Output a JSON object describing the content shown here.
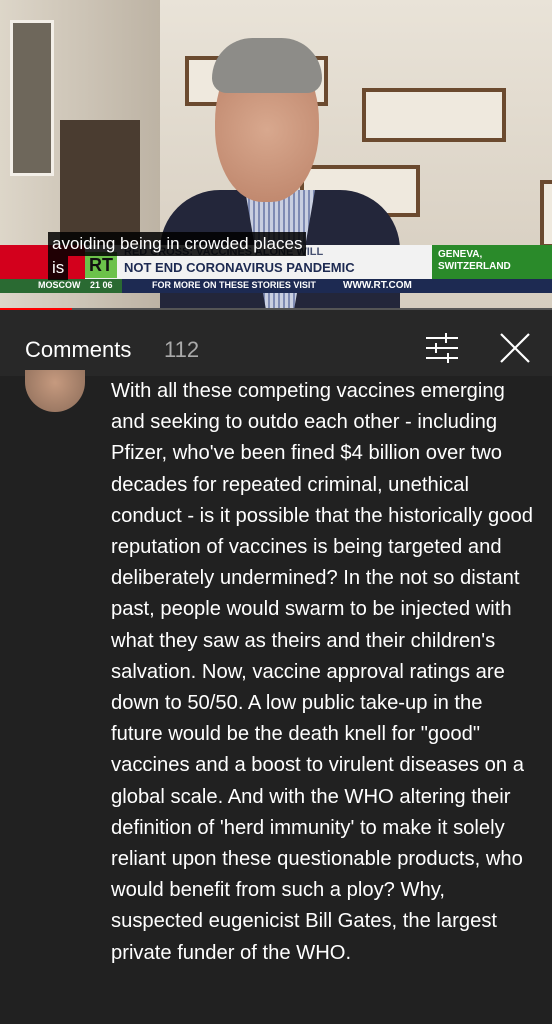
{
  "video": {
    "captions": [
      "avoiding being in crowded places",
      "is"
    ],
    "headline_top": "RED CROSS: VACCINES ALONE WILL",
    "headline": "NOT END CORONAVIRUS PANDEMIC",
    "channel_logo": "RT",
    "location_line1": "GENEVA,",
    "location_line2": "SWITZERLAND",
    "ticker_city": "MOSCOW",
    "ticker_time": "21 06",
    "ticker_text": "FOR MORE ON THESE STORIES VISIT",
    "ticker_url": "WWW.RT.COM",
    "progress_fraction": 0.13
  },
  "comments": {
    "title": "Comments",
    "count": "112",
    "sort_icon": "sort-filter-icon",
    "close_icon": "close-icon"
  },
  "comment": {
    "text": "With all these competing vaccines emerging and seeking to outdo each other - including Pfizer, who've been fined $4 billion over two decades for repeated criminal, unethical conduct - is it possible that the historically good reputation of vaccines is being targeted and deliberately undermined? In the not so distant past, people would swarm to be injected with what they saw as theirs and their children's salvation. Now, vaccine approval ratings are down to 50/50. A low public take-up in the future would be the death knell for \"good\" vaccines and a boost to virulent diseases on a global scale. And with the WHO altering their definition of 'herd immunity' to make it solely reliant upon these questionable products, who would benefit from such a ploy? Why, suspected eugenicist Bill Gates, the largest private funder of the WHO."
  }
}
